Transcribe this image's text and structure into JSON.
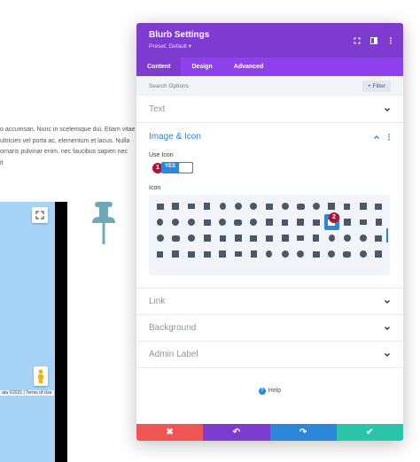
{
  "background": {
    "text_lines": [
      "o accumsan. Nunc in scelerisque dui. Etiam vitae",
      "ultricies vel porta ac, elementum et lacus. Nulla",
      "ornaris pulvinar enim, nec faucibus sapien nec",
      "it"
    ],
    "map_attribution": "ata ©2021 | Terms of Use"
  },
  "modal": {
    "title": "Blurb Settings",
    "preset": "Preset: Default ▾",
    "tabs": [
      {
        "label": "Content",
        "active": true
      },
      {
        "label": "Design",
        "active": false
      },
      {
        "label": "Advanced",
        "active": false
      }
    ],
    "search_placeholder": "Search Options",
    "filter_label": "+ Filter",
    "sections": {
      "text": "Text",
      "image_icon": "Image & Icon",
      "link": "Link",
      "background": "Background",
      "admin_label": "Admin Label"
    },
    "use_icon_label": "Use Icon",
    "toggle_value": "YES",
    "icon_label": "Icon",
    "badge1": "1",
    "badge2": "2",
    "help": "Help",
    "footer": {
      "cancel": "✖",
      "undo": "↶",
      "redo": "↷",
      "save": "✔"
    }
  },
  "colors": {
    "header": "#7e3bd0",
    "tabs": "#8f42ec",
    "accent": "#2b87da",
    "cancel": "#ef5555",
    "undo": "#7e3bd0",
    "redo": "#2b87da",
    "save": "#29c4a9",
    "badge": "#b8102d"
  }
}
